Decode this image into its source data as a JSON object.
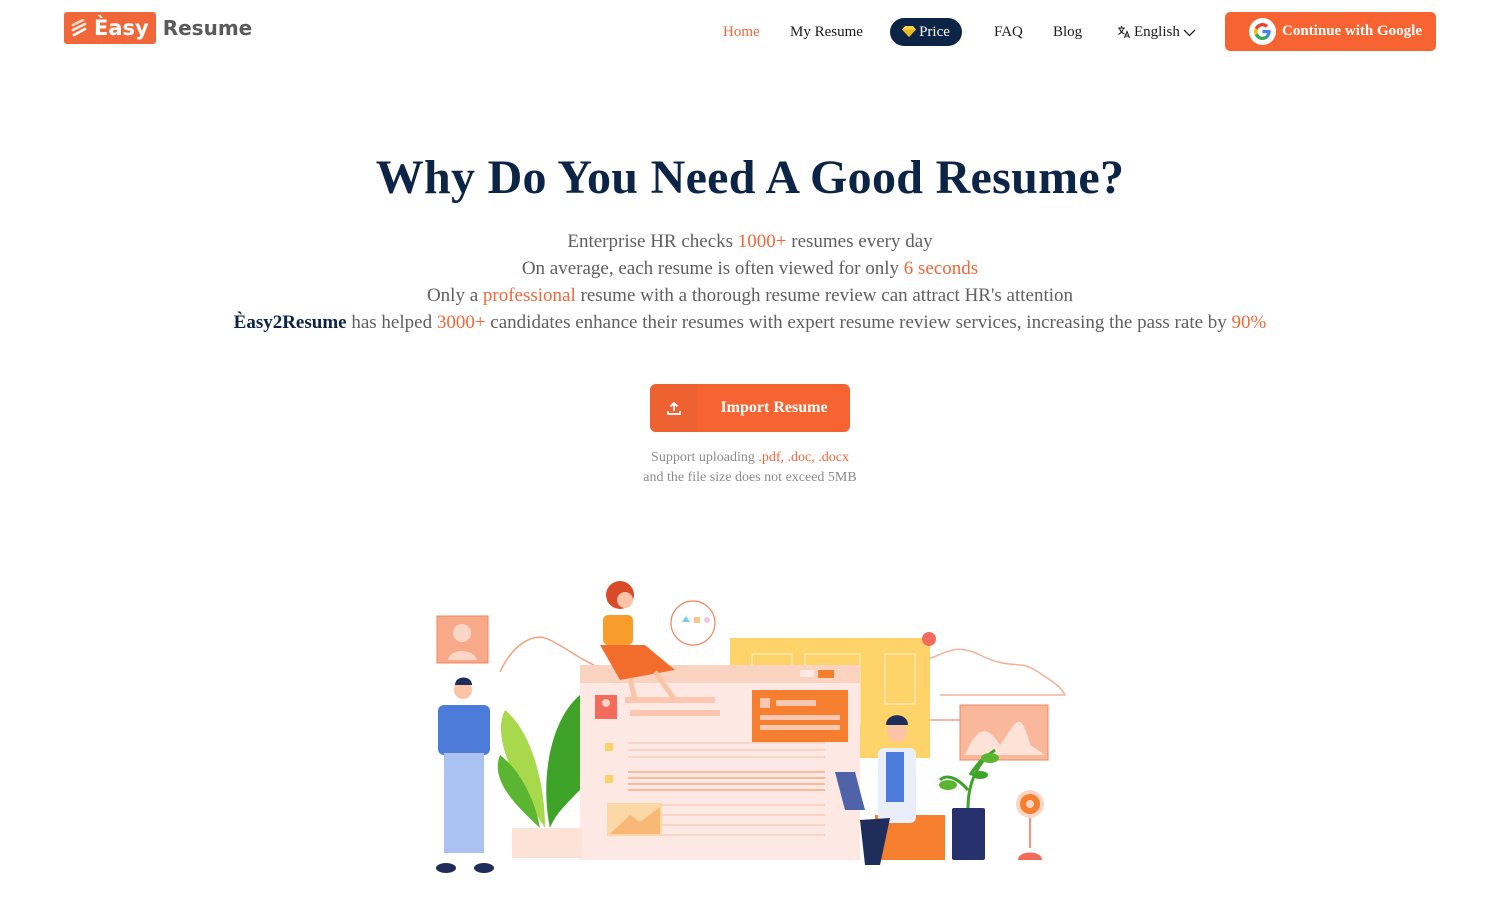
{
  "header": {
    "logo": {
      "box_text": "Èasy",
      "text": "Resume"
    },
    "nav": [
      {
        "label": "Home",
        "active": true
      },
      {
        "label": "My Resume",
        "active": false
      },
      {
        "label": "Price",
        "icon": "diamond-icon",
        "active": false
      },
      {
        "label": "FAQ",
        "active": false
      },
      {
        "label": "Blog",
        "active": false
      }
    ],
    "language": {
      "label": "English",
      "icon": "translate-icon"
    },
    "google_button": {
      "label": "Continue with Google",
      "icon": "google-icon"
    }
  },
  "hero": {
    "title": "Why Do You Need A Good Resume?",
    "line1": {
      "pre": "Enterprise HR checks ",
      "highlight": "1000+",
      "post": " resumes every day"
    },
    "line2": {
      "pre": "On average, each resume is often viewed for only ",
      "highlight": "6 seconds",
      "post": ""
    },
    "line3": {
      "pre": "Only a ",
      "highlight": "professional",
      "post": " resume with a thorough resume review can attract HR's attention"
    },
    "line4": {
      "brand": "Èasy2Resume",
      "pre": " has helped ",
      "highlight": "3000+",
      "mid": " candidates enhance their resumes with expert resume review services, increasing the pass rate by ",
      "highlight2": "90%"
    }
  },
  "import": {
    "label": "Import Resume",
    "icon": "upload-icon",
    "support_pre": "Support uploading ",
    "formats": ".pdf, .doc, .docx",
    "size_note": "and the file size does not exceed 5MB"
  },
  "colors": {
    "accent": "#f26739",
    "navy": "#0c2446",
    "button": "#f76432"
  }
}
